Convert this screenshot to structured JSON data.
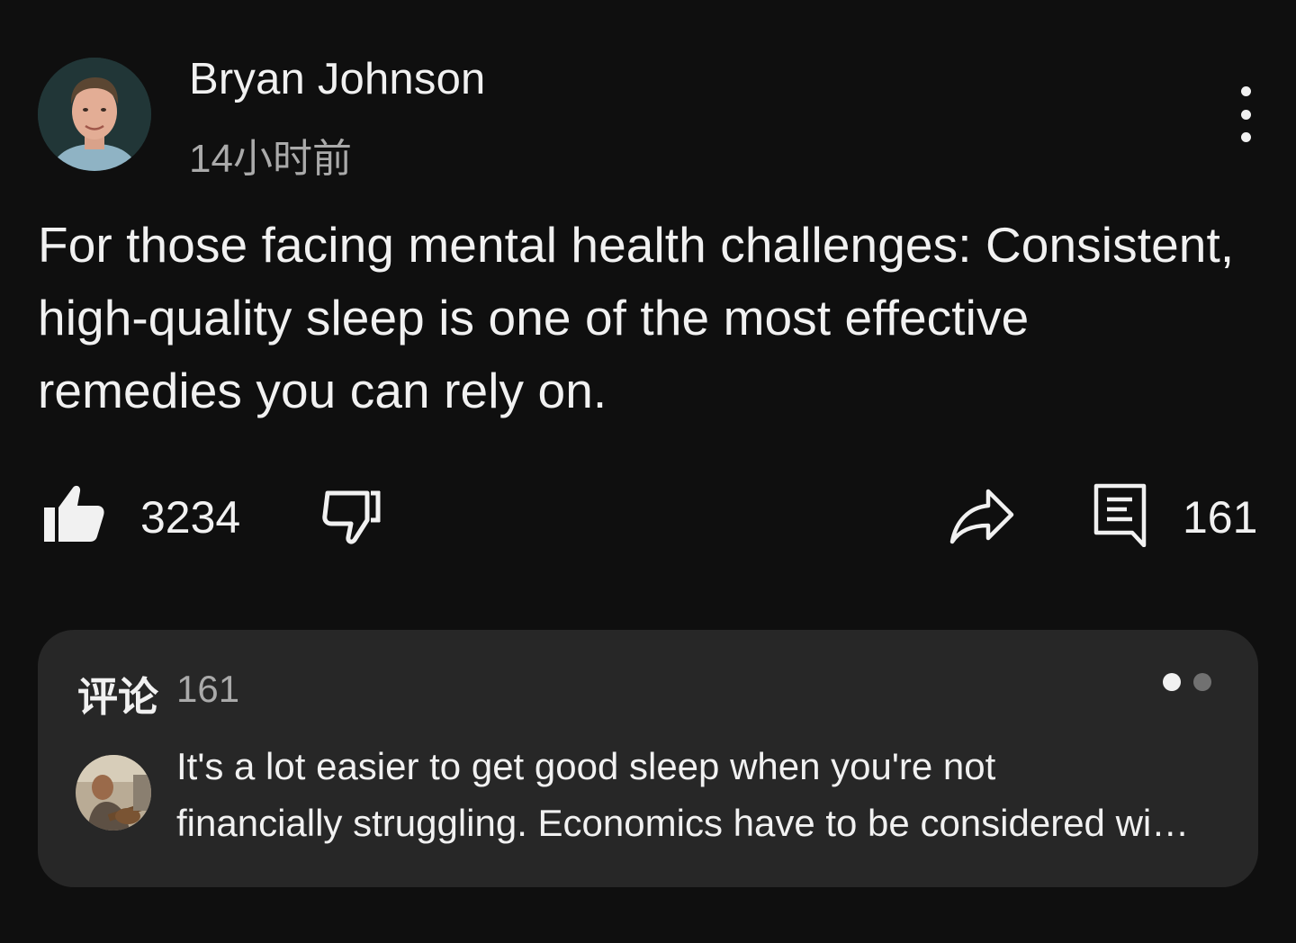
{
  "post": {
    "author": "Bryan Johnson",
    "time": "14小时前",
    "text": "For those facing mental health challenges: Consistent, high-quality sleep is one of the most effective remedies you can rely on.",
    "more_icon": "more-vertical-icon"
  },
  "actions": {
    "like_count": "3234",
    "like_icon": "thumbs-up-filled-icon",
    "dislike_icon": "thumbs-down-outline-icon",
    "share_icon": "share-arrow-icon",
    "comment_icon": "comment-icon",
    "comment_count": "161"
  },
  "comments": {
    "title": "评论",
    "count": "161",
    "pager": {
      "total": 2,
      "active": 0
    },
    "preview": {
      "text": "It's a lot easier to get good sleep when you're not\nfinancially struggling. Economics have to be considered wi…"
    }
  },
  "colors": {
    "background": "#0f0f0f",
    "card": "#272727",
    "text_primary": "#f1f1f1",
    "text_secondary": "#aaaaaa"
  }
}
